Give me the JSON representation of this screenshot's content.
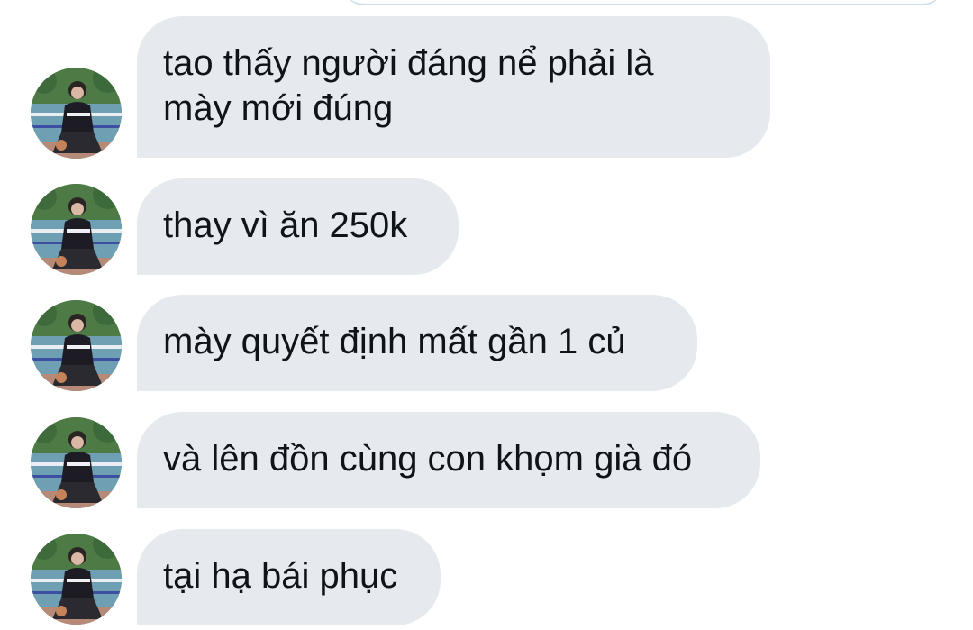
{
  "conversation": {
    "messages": [
      {
        "lines": [
          "tao thấy người đáng nể phải là",
          "mày mới đúng"
        ]
      },
      {
        "lines": [
          "thay vì ăn 250k"
        ]
      },
      {
        "lines": [
          "mày quyết định mất gần 1 củ"
        ]
      },
      {
        "lines": [
          "và lên đồn cùng con khọm già đó"
        ]
      },
      {
        "lines": [
          "tại hạ bái phục"
        ]
      }
    ]
  },
  "colors": {
    "bubble_bg": "#e6eaee",
    "text": "#0f1419",
    "outgoing_edge": "#c9dff0"
  },
  "icons": {
    "avatar": "user-avatar-photo"
  }
}
